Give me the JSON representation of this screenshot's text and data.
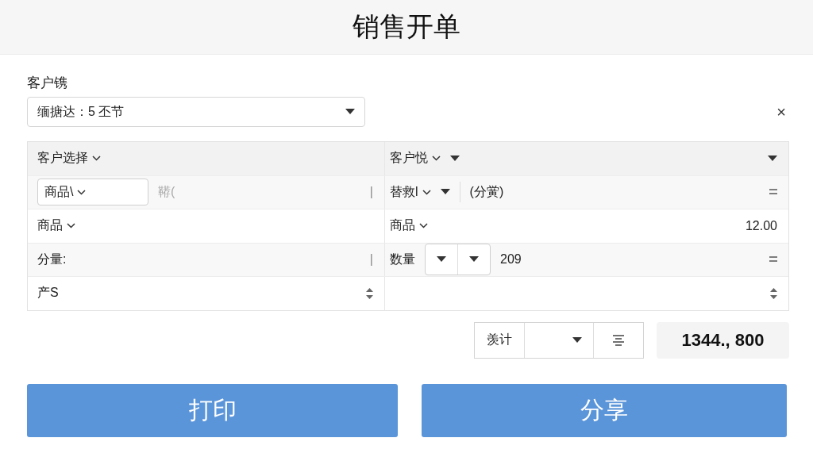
{
  "title": "销售开单",
  "customer": {
    "label": "客户镌",
    "value": "缅搪达：5 丕节",
    "close": "×"
  },
  "grid": [
    {
      "cells": [
        {
          "start": [
            {
              "kind": "dropdown",
              "text": "客户选择"
            }
          ]
        },
        {
          "start": [
            {
              "kind": "dropdown",
              "text": "客户悦"
            },
            {
              "kind": "caret"
            }
          ],
          "end": [
            {
              "kind": "caret"
            }
          ]
        }
      ]
    },
    {
      "cells": [
        {
          "start": [
            {
              "kind": "boxed-dropdown",
              "text": "商品\\"
            },
            {
              "kind": "muted",
              "text": "鞯("
            }
          ],
          "end": [
            {
              "kind": "cursor",
              "text": "|"
            }
          ]
        },
        {
          "start": [
            {
              "kind": "dropdown",
              "text": "替救l"
            },
            {
              "kind": "caret"
            },
            {
              "kind": "divider"
            },
            {
              "kind": "value",
              "text": "(分黉)"
            }
          ],
          "end": [
            {
              "kind": "equals"
            }
          ]
        }
      ]
    },
    {
      "cells": [
        {
          "start": [
            {
              "kind": "dropdown",
              "text": "商品"
            }
          ]
        },
        {
          "start": [
            {
              "kind": "dropdown",
              "text": "商品"
            }
          ],
          "end": [
            {
              "kind": "value",
              "text": "12.00"
            }
          ]
        }
      ]
    },
    {
      "cells": [
        {
          "start": [
            {
              "kind": "text",
              "text": "分量:"
            }
          ],
          "end": [
            {
              "kind": "cursor",
              "text": "|"
            }
          ]
        },
        {
          "start": [
            {
              "kind": "text",
              "text": "数量"
            },
            {
              "kind": "caret-box"
            },
            {
              "kind": "value",
              "text": "209"
            }
          ],
          "end": [
            {
              "kind": "equals"
            }
          ]
        }
      ]
    },
    {
      "cells": [
        {
          "start": [
            {
              "kind": "text",
              "text": "产S"
            }
          ],
          "end": [
            {
              "kind": "spinner"
            }
          ]
        },
        {
          "end": [
            {
              "kind": "spinner"
            }
          ]
        }
      ]
    }
  ],
  "totals": {
    "label": "羡计",
    "amount": "1344., 800"
  },
  "buttons": [
    {
      "label": "打印"
    },
    {
      "label": "分享"
    }
  ]
}
